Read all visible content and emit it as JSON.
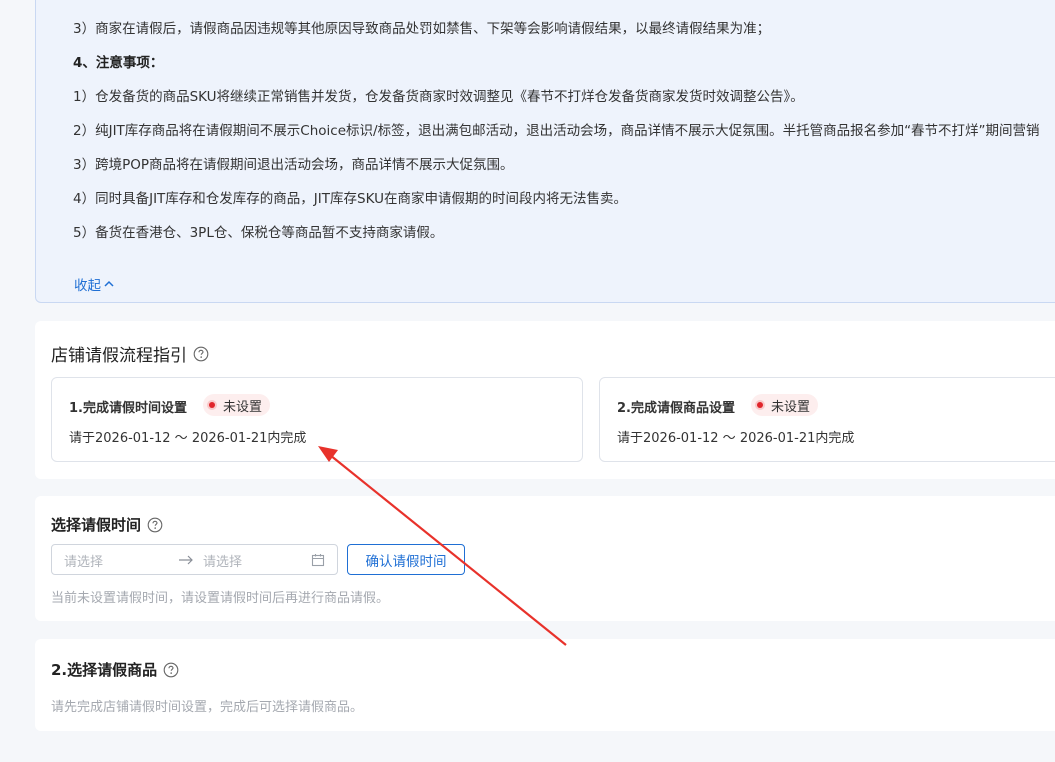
{
  "notice": {
    "lines": [
      "3）商家在请假后，请假商品因违规等其他原因导致商品处罚如禁售、下架等会影响请假结果，以最终请假结果为准；",
      "4、注意事项：",
      "1）仓发备货的商品SKU将继续正常销售并发货，仓发备货商家时效调整见《春节不打烊仓发备货商家发货时效调整公告》。",
      "2）纯JIT库存商品将在请假期间不展示Choice标识/标签，退出满包邮活动，退出活动会场，商品详情不展示大促氛围。半托管商品报名参加“春节不打烊”期间营销",
      "3）跨境POP商品将在请假期间退出活动会场，商品详情不展示大促氛围。",
      "4）同时具备JIT库存和仓发库存的商品，JIT库存SKU在商家申请假期的时间段内将无法售卖。",
      "5）备货在香港仓、3PL仓、保税仓等商品暂不支持商家请假。"
    ],
    "collapse_label": "收起"
  },
  "guide": {
    "title": "店铺请假流程指引",
    "steps": [
      {
        "title": "1.完成请假时间设置",
        "status": "未设置",
        "desc": "请于2026-01-12 ～ 2026-01-21内完成"
      },
      {
        "title": "2.完成请假商品设置",
        "status": "未设置",
        "desc": "请于2026-01-12 ～ 2026-01-21内完成"
      }
    ]
  },
  "time_section": {
    "title": "选择请假时间",
    "start_placeholder": "请选择",
    "end_placeholder": "请选择",
    "confirm_label": "确认请假时间",
    "hint": "当前未设置请假时间，请设置请假时间后再进行商品请假。"
  },
  "goods_section": {
    "title": "2.选择请假商品",
    "hint": "请先完成店铺请假时间设置，完成后可选择请假商品。"
  },
  "colors": {
    "accent": "#1f6fd4",
    "status_dot": "#e0242a",
    "annotation_arrow": "#e8322b"
  }
}
